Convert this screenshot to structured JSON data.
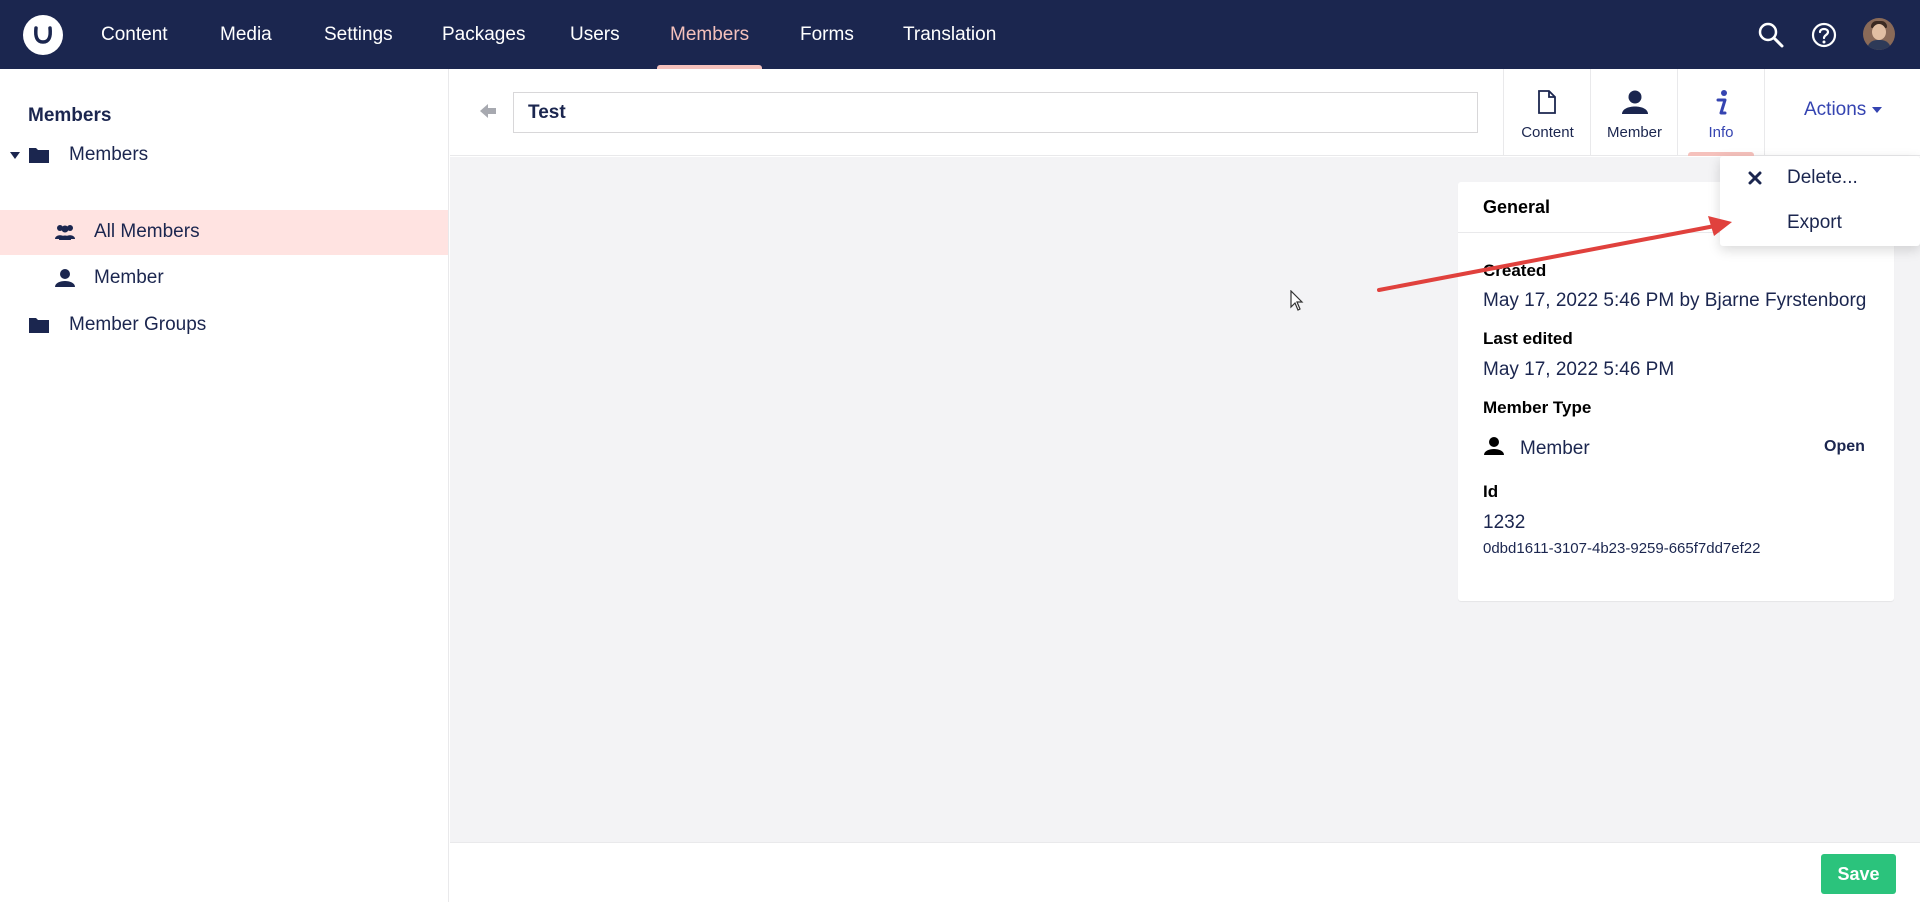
{
  "topnav": {
    "items": [
      {
        "label": "Content"
      },
      {
        "label": "Media"
      },
      {
        "label": "Settings"
      },
      {
        "label": "Packages"
      },
      {
        "label": "Users"
      },
      {
        "label": "Members",
        "active": true
      },
      {
        "label": "Forms"
      },
      {
        "label": "Translation"
      }
    ],
    "icons": [
      "umbraco-logo-icon",
      "search-icon",
      "help-icon",
      "user-avatar"
    ]
  },
  "sidebar": {
    "title": "Members",
    "tree": [
      {
        "label": "Members",
        "icon": "folder-icon",
        "expanded": true
      },
      {
        "label": "All Members",
        "icon": "users-icon",
        "selected": true
      },
      {
        "label": "Member",
        "icon": "user-icon"
      },
      {
        "label": "Member Groups",
        "icon": "folder-icon"
      }
    ]
  },
  "editor": {
    "name_value": "Test",
    "apps": [
      {
        "label": "Content",
        "icon": "document-icon"
      },
      {
        "label": "Member",
        "icon": "user-icon"
      },
      {
        "label": "Info",
        "icon": "info-icon",
        "active": true
      }
    ],
    "actions_label": "Actions"
  },
  "actions_menu": {
    "items": [
      {
        "label": "Delete...",
        "icon": "close-icon"
      },
      {
        "label": "Export"
      }
    ]
  },
  "info": {
    "title": "General",
    "created_label": "Created",
    "created_value": "May 17, 2022 5:46 PM by Bjarne Fyrstenborg",
    "last_edited_label": "Last edited",
    "last_edited_value": "May 17, 2022 5:46 PM",
    "member_type_label": "Member Type",
    "member_type_value": "Member",
    "open_label": "Open",
    "id_label": "Id",
    "id_value": "1232",
    "key_value": "0dbd1611-3107-4b23-9259-665f7dd7ef22"
  },
  "footer": {
    "save_label": "Save"
  },
  "colors": {
    "header_bg": "#1b264f",
    "active_accent": "#f5c1bc",
    "selected_row": "#ffe3e1",
    "link_blue": "#3544b1",
    "save_green": "#2bc37c",
    "annotation_red": "#e0413d"
  }
}
